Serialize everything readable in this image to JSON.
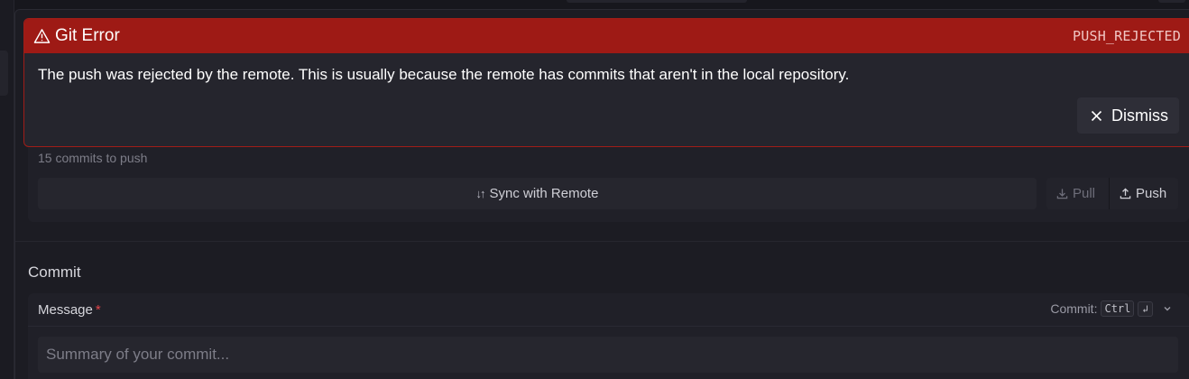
{
  "error": {
    "title": "Git Error",
    "code": "PUSH_REJECTED",
    "message": "The push was rejected by the remote. This is usually because the remote has commits that aren't in the local repository.",
    "dismiss_label": "Dismiss",
    "icon": "warning-icon",
    "color": "#9e1a15"
  },
  "sync": {
    "commits_to_push": "15 commits to push",
    "sync_label": "Sync with Remote",
    "sync_icon": "↓↑",
    "pull_label": "Pull",
    "push_label": "Push"
  },
  "commit": {
    "section_title": "Commit",
    "message_label": "Message",
    "required_mark": "*",
    "shortcut_label": "Commit:",
    "shortcut_key": "Ctrl",
    "shortcut_enter": "↲",
    "placeholder": "Summary of your commit..."
  }
}
